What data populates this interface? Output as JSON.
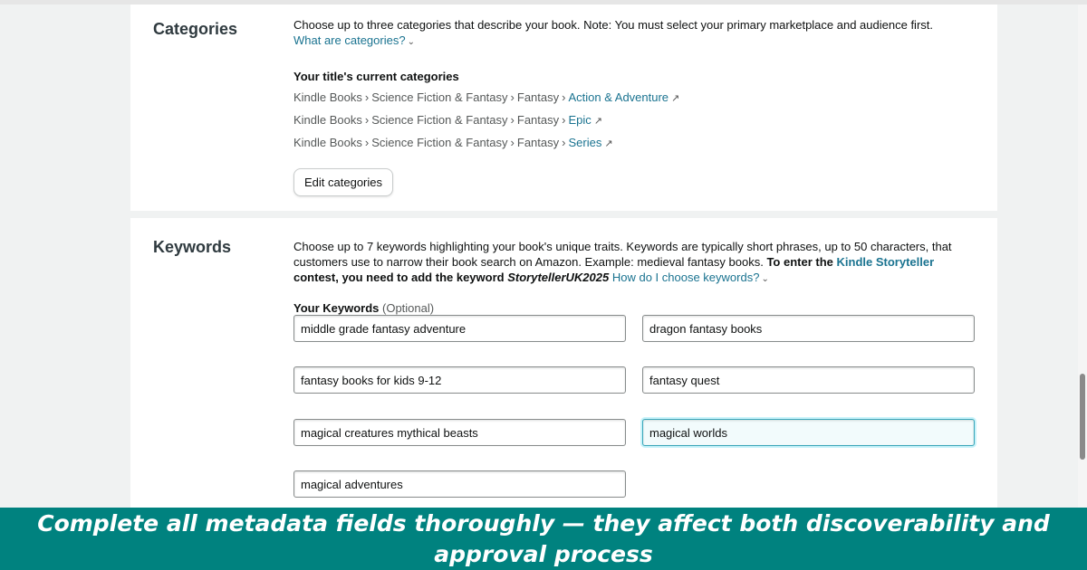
{
  "categories": {
    "heading": "Categories",
    "description": "Choose up to three categories that describe your book. Note: You must select your primary marketplace and audience first.",
    "help_link": "What are categories?",
    "current_title": "Your title's current categories",
    "rows": [
      {
        "path": [
          "Kindle Books",
          "Science Fiction & Fantasy",
          "Fantasy"
        ],
        "leaf": "Action & Adventure"
      },
      {
        "path": [
          "Kindle Books",
          "Science Fiction & Fantasy",
          "Fantasy"
        ],
        "leaf": "Epic"
      },
      {
        "path": [
          "Kindle Books",
          "Science Fiction & Fantasy",
          "Fantasy"
        ],
        "leaf": "Series"
      }
    ],
    "separator": "›",
    "edit_button": "Edit categories"
  },
  "keywords": {
    "heading": "Keywords",
    "desc_part1": "Choose up to 7 keywords highlighting your book's unique traits. Keywords are typically short phrases, up to 50 characters, that customers use to narrow their book search on Amazon. Example: medieval fantasy books.",
    "desc_bold1": "To enter the",
    "storyteller_link": "Kindle Storyteller",
    "desc_bold2": "contest, you need to add the keyword",
    "contest_keyword": "StorytellerUK2025",
    "help_link": "How do I choose keywords?",
    "label": "Your Keywords",
    "optional": "(Optional)",
    "values": [
      "middle grade fantasy adventure",
      "dragon fantasy books",
      "fantasy books for kids 9-12",
      "fantasy quest",
      "magical creatures mythical beasts",
      "magical worlds",
      "magical adventures"
    ]
  },
  "banner": {
    "text": "Complete all metadata fields thoroughly — they affect both discoverability and approval process"
  },
  "colors": {
    "link": "#1a7390",
    "banner": "#00827f",
    "focus": "#3aa6b9"
  },
  "icons": {
    "chevron": "chevron-down-icon",
    "external": "external-link-icon"
  }
}
